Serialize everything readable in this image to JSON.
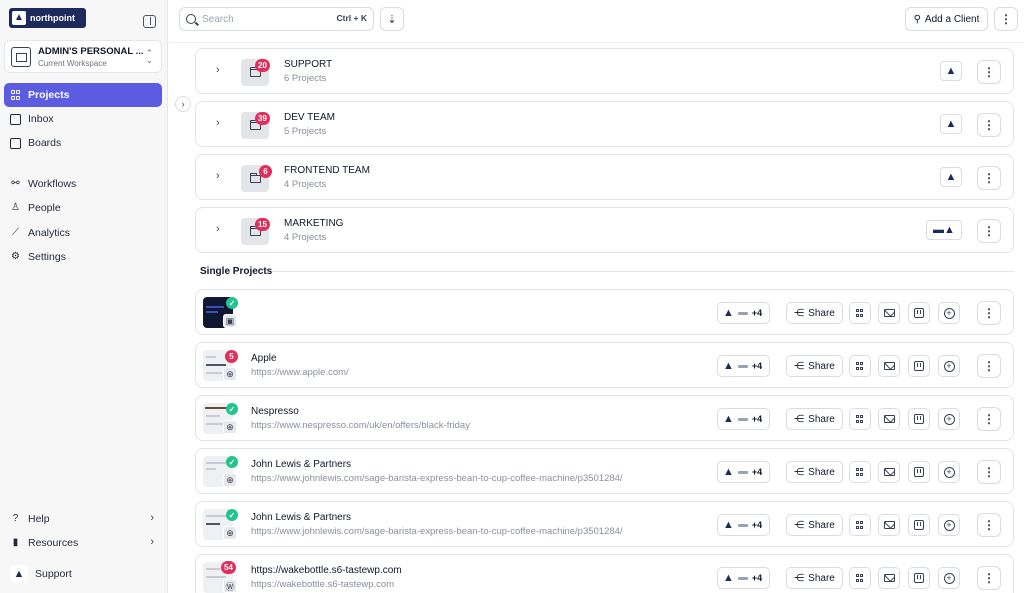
{
  "sidebar": {
    "logo_text": "northpoint",
    "workspace": {
      "name": "ADMIN'S PERSONAL ...",
      "subtitle": "Current Workspace"
    },
    "items": [
      {
        "label": "Projects",
        "icon": "grid-icon"
      },
      {
        "label": "Inbox",
        "icon": "inbox-icon"
      },
      {
        "label": "Boards",
        "icon": "board-icon"
      },
      {
        "label": "Workflows",
        "icon": "workflow-icon"
      },
      {
        "label": "People",
        "icon": "person-icon"
      },
      {
        "label": "Analytics",
        "icon": "chart-icon"
      },
      {
        "label": "Settings",
        "icon": "gear-icon"
      }
    ],
    "bottom": [
      {
        "label": "Help",
        "icon": "help-icon"
      },
      {
        "label": "Resources",
        "icon": "bar-chart-icon"
      },
      {
        "label": "Support",
        "icon": "support-avatar"
      }
    ]
  },
  "topbar": {
    "search_placeholder": "Search",
    "search_shortcut": "Ctrl + K",
    "add_client_label": "Add a Client"
  },
  "folders": [
    {
      "name": "SUPPORT",
      "sub": "6 Projects",
      "count": "20"
    },
    {
      "name": "DEV TEAM",
      "sub": "5 Projects",
      "count": "39"
    },
    {
      "name": "FRONTEND TEAM",
      "sub": "4 Projects",
      "count": "6"
    },
    {
      "name": "MARKETING",
      "sub": "4 Projects",
      "count": "15"
    }
  ],
  "single_projects_title": "Single Projects",
  "projects": [
    {
      "name": "",
      "url": "",
      "status": "check",
      "type": "image-icon",
      "members_extra": "+4",
      "share_label": "Share"
    },
    {
      "name": "Apple",
      "url": "https://www.apple.com/",
      "status": "5",
      "type": "globe-icon",
      "members_extra": "+4",
      "share_label": "Share"
    },
    {
      "name": "Nespresso",
      "url": "https://www.nespresso.com/uk/en/offers/black-friday",
      "status": "check",
      "type": "globe-icon",
      "members_extra": "+4",
      "share_label": "Share"
    },
    {
      "name": "John Lewis & Partners",
      "url": "https://www.johnlewis.com/sage-barista-express-bean-to-cup-coffee-machine/p3501284/",
      "status": "check",
      "type": "globe-icon",
      "members_extra": "+4",
      "share_label": "Share"
    },
    {
      "name": "John Lewis & Partners",
      "url": "https://www.johnlewis.com/sage-barista-express-bean-to-cup-coffee-machine/p3501284/",
      "status": "check",
      "type": "globe-icon",
      "members_extra": "+4",
      "share_label": "Share"
    },
    {
      "name": "https://wakebottle.s6-tastewp.com",
      "url": "https://wakebottle.s6-tastewp.com",
      "status": "54",
      "type": "wordpress-icon",
      "members_extra": "+4",
      "share_label": "Share"
    }
  ],
  "colors": {
    "accent": "#5b5ce2",
    "badge": "#e02f5c",
    "check": "#21c48d",
    "brand": "#1f2a5c"
  }
}
